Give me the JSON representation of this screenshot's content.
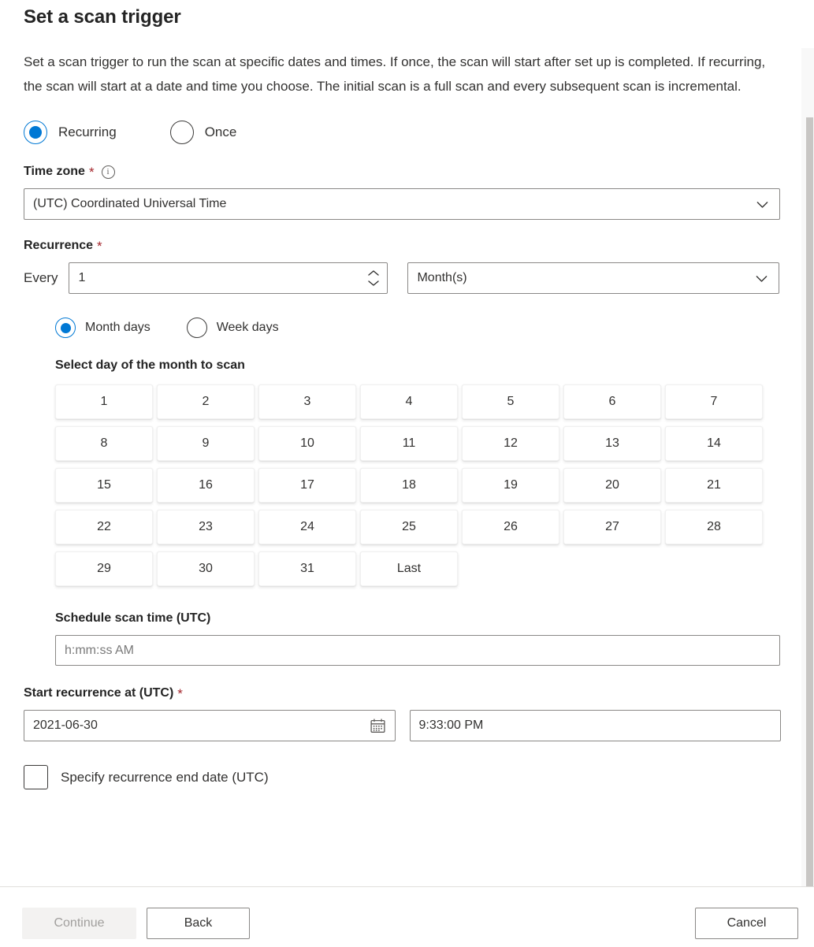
{
  "page": {
    "title": "Set a scan trigger",
    "description": "Set a scan trigger to run the scan at specific dates and times. If once, the scan will start after set up is completed. If recurring, the scan will start at a date and time you choose. The initial scan is a full scan and every subsequent scan is incremental."
  },
  "trigger_mode": {
    "options": [
      {
        "label": "Recurring",
        "selected": true
      },
      {
        "label": "Once",
        "selected": false
      }
    ]
  },
  "time_zone": {
    "label": "Time zone",
    "required_marker": "*",
    "info_icon": "info-icon",
    "value": "(UTC) Coordinated Universal Time",
    "chevron_icon": "chevron-down-icon"
  },
  "recurrence": {
    "label": "Recurrence",
    "required_marker": "*",
    "every_label": "Every",
    "interval_value": "1",
    "spinner_up_icon": "chevron-up-icon",
    "spinner_down_icon": "chevron-down-icon",
    "unit_value": "Month(s)",
    "unit_chevron_icon": "chevron-down-icon",
    "day_mode": {
      "options": [
        {
          "label": "Month days",
          "selected": true
        },
        {
          "label": "Week days",
          "selected": false
        }
      ]
    },
    "day_grid": {
      "title": "Select day of the month to scan",
      "days": [
        "1",
        "2",
        "3",
        "4",
        "5",
        "6",
        "7",
        "8",
        "9",
        "10",
        "11",
        "12",
        "13",
        "14",
        "15",
        "16",
        "17",
        "18",
        "19",
        "20",
        "21",
        "22",
        "23",
        "24",
        "25",
        "26",
        "27",
        "28",
        "29",
        "30",
        "31",
        "Last"
      ]
    },
    "schedule_scan_time": {
      "label": "Schedule scan time (UTC)",
      "value": "",
      "placeholder": "h:mm:ss AM"
    }
  },
  "start_recurrence": {
    "label": "Start recurrence at (UTC)",
    "required_marker": "*",
    "date_value": "2021-06-30",
    "calendar_icon": "calendar-icon",
    "time_value": "9:33:00 PM"
  },
  "end_date": {
    "checkbox_checked": false,
    "label": "Specify recurrence end date (UTC)"
  },
  "footer": {
    "continue_label": "Continue",
    "continue_disabled": true,
    "back_label": "Back",
    "cancel_label": "Cancel"
  },
  "colors": {
    "accent": "#0078d4",
    "required": "#a4262c",
    "text": "#323130",
    "border": "#8a8886",
    "disabled_bg": "#f3f2f1",
    "disabled_text": "#a19f9d"
  }
}
